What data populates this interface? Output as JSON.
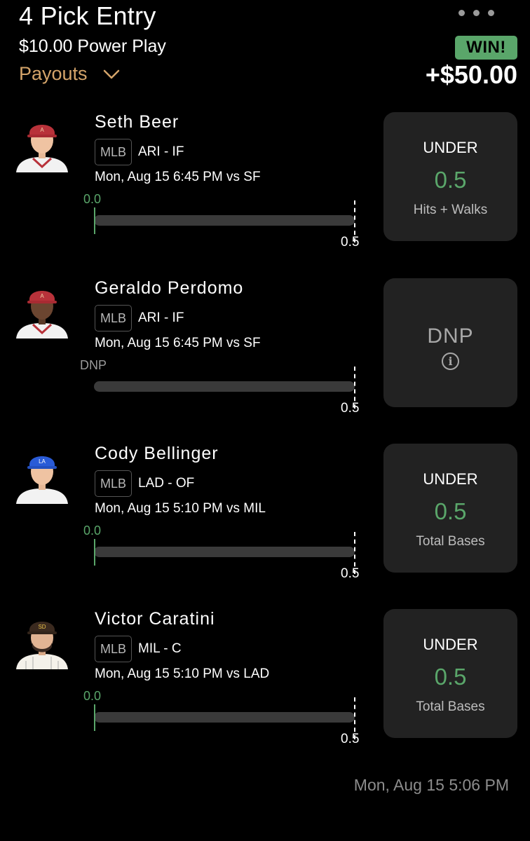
{
  "header": {
    "title": "4 Pick Entry",
    "entry_type": "$10.00 Power Play",
    "payouts_label": "Payouts",
    "status_badge": "WIN!",
    "winnings": "+$50.00"
  },
  "picks": [
    {
      "player": "Seth Beer",
      "league": "MLB",
      "team_position": "ARI - IF",
      "game_time": "Mon, Aug 15 6:45 PM  vs SF",
      "current_value": "0.0",
      "line_label": "0.5",
      "direction": "UNDER",
      "line": "0.5",
      "stat": "Hits + Walks",
      "cap_color": "#b8323a"
    },
    {
      "player": "Geraldo Perdomo",
      "league": "MLB",
      "team_position": "ARI - IF",
      "game_time": "Mon, Aug 15 6:45 PM  vs SF",
      "current_value": "DNP",
      "line_label": "0.5",
      "status": "DNP",
      "info_icon": "info-icon",
      "cap_color": "#b8323a"
    },
    {
      "player": "Cody Bellinger",
      "league": "MLB",
      "team_position": "LAD - OF",
      "game_time": "Mon, Aug 15 5:10 PM  vs MIL",
      "current_value": "0.0",
      "line_label": "0.5",
      "direction": "UNDER",
      "line": "0.5",
      "stat": "Total Bases",
      "cap_color": "#2a5bd7"
    },
    {
      "player": "Victor Caratini",
      "league": "MLB",
      "team_position": "MIL - C",
      "game_time": "Mon, Aug 15 5:10 PM  vs LAD",
      "current_value": "0.0",
      "line_label": "0.5",
      "direction": "UNDER",
      "line": "0.5",
      "stat": "Total Bases",
      "cap_color": "#3b2a1f"
    }
  ],
  "footer": {
    "timestamp": "Mon, Aug 15 5:06 PM"
  },
  "colors": {
    "win_green": "#5aa66a",
    "payouts_gold": "#d4a46a",
    "card_bg": "#222222"
  }
}
